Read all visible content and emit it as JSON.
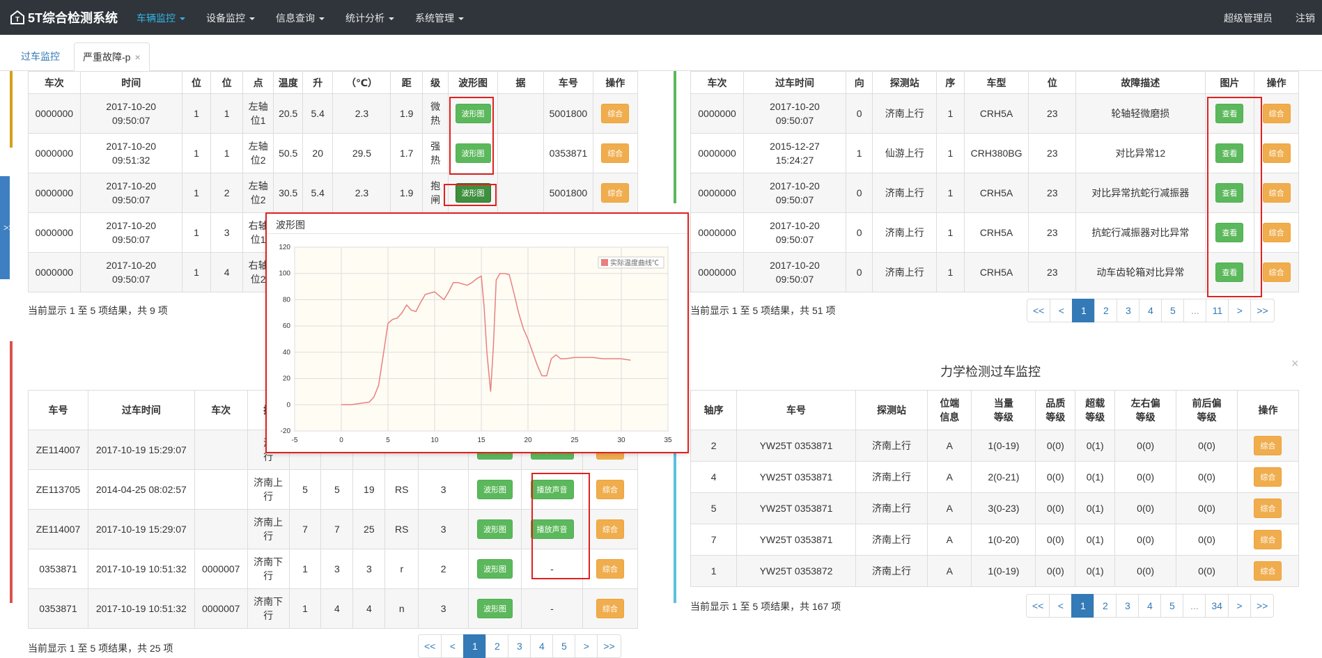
{
  "navbar": {
    "brand": "5T综合检测系统",
    "menus": [
      {
        "label": "车辆监控",
        "active": true
      },
      {
        "label": "设备监控",
        "active": false
      },
      {
        "label": "信息查询",
        "active": false
      },
      {
        "label": "统计分析",
        "active": false
      },
      {
        "label": "系统管理",
        "active": false
      }
    ],
    "user": "超级管理员",
    "logout": "注销",
    "accent": "#33b5e5"
  },
  "tabs": {
    "monitor": "过车监控",
    "current": "严重故障-p",
    "close": "×"
  },
  "side_toggle": ">>",
  "panel_tl": {
    "headers": [
      "车次",
      "时间",
      "位",
      "位",
      "点",
      "温度",
      "升",
      "（℃）",
      "距",
      "级",
      "波形图",
      "据",
      "车号",
      "操作"
    ],
    "rows": [
      {
        "train": "0000000",
        "date": "2017-10-20",
        "time": "09:50:07",
        "c1": "1",
        "c2": "1",
        "p1": "左轴",
        "p2": "位1",
        "temp": "20.5",
        "rise": "5.4",
        "tc": "2.3",
        "dist": "1.9",
        "l1": "微",
        "l2": "热",
        "btn": "波形图",
        "data": "",
        "car": "5001800",
        "op": "综合"
      },
      {
        "train": "0000000",
        "date": "2017-10-20",
        "time": "09:51:32",
        "c1": "1",
        "c2": "1",
        "p1": "左轴",
        "p2": "位2",
        "temp": "50.5",
        "rise": "20",
        "tc": "29.5",
        "dist": "1.7",
        "l1": "强",
        "l2": "热",
        "btn": "波形图",
        "data": "",
        "car": "0353871",
        "op": "综合"
      },
      {
        "train": "0000000",
        "date": "2017-10-20",
        "time": "09:50:07",
        "c1": "1",
        "c2": "2",
        "p1": "左轴",
        "p2": "位2",
        "temp": "30.5",
        "rise": "5.4",
        "tc": "2.3",
        "dist": "1.9",
        "l1": "抱",
        "l2": "闸",
        "btn": "波形图",
        "data": "",
        "car": "5001800",
        "op": "综合"
      },
      {
        "train": "0000000",
        "date": "2017-10-20",
        "time": "09:50:07",
        "c1": "1",
        "c2": "3",
        "p1": "右轴",
        "p2": "位1",
        "temp": "",
        "rise": "",
        "tc": "",
        "dist": "",
        "l1": "",
        "l2": "",
        "btn": "",
        "data": "",
        "car": "",
        "op": ""
      },
      {
        "train": "0000000",
        "date": "2017-10-20",
        "time": "09:50:07",
        "c1": "1",
        "c2": "4",
        "p1": "右轴",
        "p2": "位2",
        "temp": "",
        "rise": "",
        "tc": "",
        "dist": "",
        "l1": "",
        "l2": "",
        "btn": "",
        "data": "",
        "car": "",
        "op": ""
      }
    ],
    "footer": "当前显示 1 至 5 项结果，共 9 项"
  },
  "panel_tr": {
    "headers": [
      "车次",
      "过车时间",
      "向",
      "探测站",
      "序",
      "车型",
      "位",
      "故障描述",
      "图片",
      "操作"
    ],
    "rows": [
      {
        "train": "0000000",
        "date": "2017-10-20",
        "time": "09:50:07",
        "dir": "0",
        "station": "济南上行",
        "seq": "1",
        "type": "CRH5A",
        "pos": "23",
        "desc": "轮轴轻微磨损",
        "btn": "查看",
        "op": "综合"
      },
      {
        "train": "0000000",
        "date": "2015-12-27",
        "time": "15:24:27",
        "dir": "1",
        "station": "仙游上行",
        "seq": "1",
        "type": "CRH380BG",
        "pos": "23",
        "desc": "对比异常12",
        "btn": "查看",
        "op": "综合"
      },
      {
        "train": "0000000",
        "date": "2017-10-20",
        "time": "09:50:07",
        "dir": "0",
        "station": "济南上行",
        "seq": "1",
        "type": "CRH5A",
        "pos": "23",
        "desc": "对比异常抗蛇行减振器",
        "btn": "查看",
        "op": "综合"
      },
      {
        "train": "0000000",
        "date": "2017-10-20",
        "time": "09:50:07",
        "dir": "0",
        "station": "济南上行",
        "seq": "1",
        "type": "CRH5A",
        "pos": "23",
        "desc": "抗蛇行减振器对比异常",
        "btn": "查看",
        "op": "综合"
      },
      {
        "train": "0000000",
        "date": "2017-10-20",
        "time": "09:50:07",
        "dir": "0",
        "station": "济南上行",
        "seq": "1",
        "type": "CRH5A",
        "pos": "23",
        "desc": "动车齿轮箱对比异常",
        "btn": "查看",
        "op": "综合"
      }
    ],
    "footer": "当前显示 1 至 5 项结果，共 51 项",
    "pager": [
      "<<",
      "<",
      "1",
      "2",
      "3",
      "4",
      "5",
      "...",
      "11",
      ">",
      ">>"
    ]
  },
  "panel_bl": {
    "headers": [
      "车号",
      "过车时间",
      "车次",
      "探"
    ],
    "rows": [
      {
        "car": "ZE114007",
        "time": "2017-10-19 15:29:07",
        "train": "",
        "s1": "济",
        "s2": "行",
        "a": "",
        "b": "",
        "c": "",
        "d": "",
        "e": "",
        "wave": "波形图",
        "sound": "播放声音",
        "op": "综合"
      },
      {
        "car": "ZE113705",
        "time": "2014-04-25 08:02:57",
        "train": "",
        "s1": "济南上",
        "s2": "行",
        "a": "5",
        "b": "5",
        "c": "19",
        "d": "RS",
        "e": "3",
        "wave": "波形图",
        "sound": "播放声音",
        "op": "综合"
      },
      {
        "car": "ZE114007",
        "time": "2017-10-19 15:29:07",
        "train": "",
        "s1": "济南上",
        "s2": "行",
        "a": "7",
        "b": "7",
        "c": "25",
        "d": "RS",
        "e": "3",
        "wave": "波形图",
        "sound": "播放声音",
        "op": "综合"
      },
      {
        "car": "0353871",
        "time": "2017-10-19 10:51:32",
        "train": "0000007",
        "s1": "济南下",
        "s2": "行",
        "a": "1",
        "b": "3",
        "c": "3",
        "d": "r",
        "e": "2",
        "wave": "波形图",
        "sound": "-",
        "op": "综合"
      },
      {
        "car": "0353871",
        "time": "2017-10-19 10:51:32",
        "train": "0000007",
        "s1": "济南下",
        "s2": "行",
        "a": "1",
        "b": "4",
        "c": "4",
        "d": "n",
        "e": "3",
        "wave": "波形图",
        "sound": "-",
        "op": "综合"
      }
    ],
    "footer": "当前显示 1 至 5 项结果，共 25 项",
    "pager": [
      "<<",
      "<",
      "1",
      "2",
      "3",
      "4",
      "5",
      ">",
      ">>"
    ]
  },
  "panel_br": {
    "title": "力学检测过车监控",
    "close": "×",
    "headers": [
      [
        "轴序"
      ],
      [
        "车号"
      ],
      [
        "探测站"
      ],
      [
        "位端",
        "信息"
      ],
      [
        "当量",
        "等级"
      ],
      [
        "品质",
        "等级"
      ],
      [
        "超载",
        "等级"
      ],
      [
        "左右偏",
        "等级"
      ],
      [
        "前后偏",
        "等级"
      ],
      [
        "操作"
      ]
    ],
    "rows": [
      {
        "axle": "2",
        "car": "YW25T 0353871",
        "station": "济南上行",
        "pos": "A",
        "eq": "1(0-19)",
        "q": "0(0)",
        "over": "0(1)",
        "lr": "0(0)",
        "fb": "0(0)",
        "op": "综合"
      },
      {
        "axle": "4",
        "car": "YW25T 0353871",
        "station": "济南上行",
        "pos": "A",
        "eq": "2(0-21)",
        "q": "0(0)",
        "over": "0(1)",
        "lr": "0(0)",
        "fb": "0(0)",
        "op": "综合"
      },
      {
        "axle": "5",
        "car": "YW25T 0353871",
        "station": "济南上行",
        "pos": "A",
        "eq": "3(0-23)",
        "q": "0(0)",
        "over": "0(1)",
        "lr": "0(0)",
        "fb": "0(0)",
        "op": "综合"
      },
      {
        "axle": "7",
        "car": "YW25T 0353871",
        "station": "济南上行",
        "pos": "A",
        "eq": "1(0-20)",
        "q": "0(0)",
        "over": "0(1)",
        "lr": "0(0)",
        "fb": "0(0)",
        "op": "综合"
      },
      {
        "axle": "1",
        "car": "YW25T 0353872",
        "station": "济南上行",
        "pos": "A",
        "eq": "1(0-19)",
        "q": "0(0)",
        "over": "0(1)",
        "lr": "0(0)",
        "fb": "0(0)",
        "op": "综合"
      }
    ],
    "footer": "当前显示 1 至 5 项结果，共 167 项",
    "pager": [
      "<<",
      "<",
      "1",
      "2",
      "3",
      "4",
      "5",
      "...",
      "34",
      ">",
      ">>"
    ]
  },
  "popup": {
    "title": "波形图"
  },
  "chart_data": {
    "type": "line",
    "title": "",
    "xlabel": "",
    "ylabel": "",
    "xlim": [
      -5,
      35
    ],
    "ylim": [
      -20,
      120
    ],
    "xticks": [
      "-5",
      "0",
      "5",
      "10",
      "15",
      "20",
      "25",
      "30",
      "35"
    ],
    "yticks": [
      "-20",
      "0",
      "20",
      "40",
      "60",
      "80",
      "100",
      "120"
    ],
    "grid": true,
    "legend": "top-right",
    "series": [
      {
        "name": "实际温度曲线℃",
        "color": "#e88080",
        "x": [
          0,
          1,
          2,
          3,
          3.5,
          4,
          4.5,
          5,
          5.5,
          6,
          6.5,
          7,
          7.5,
          8,
          8.5,
          9,
          9.5,
          10,
          10.5,
          11,
          11.5,
          12,
          12.5,
          13,
          13.5,
          14,
          14.5,
          15,
          15.3,
          15.6,
          16,
          16.3,
          16.6,
          17,
          17.5,
          18,
          18.5,
          19,
          19.5,
          20,
          20.5,
          21,
          21.5,
          22,
          22.5,
          23,
          23.5,
          24,
          25,
          26,
          27,
          28,
          29,
          30,
          31
        ],
        "values": [
          0,
          0,
          1,
          2,
          6,
          15,
          38,
          62,
          65,
          66,
          70,
          76,
          72,
          71,
          78,
          84,
          85,
          86,
          83,
          80,
          86,
          93,
          93,
          92,
          91,
          93,
          96,
          98,
          75,
          40,
          10,
          45,
          95,
          100,
          100,
          99,
          85,
          70,
          58,
          50,
          40,
          30,
          22,
          22,
          35,
          38,
          35,
          35,
          36,
          36,
          36,
          35,
          35,
          35,
          34
        ]
      }
    ]
  }
}
